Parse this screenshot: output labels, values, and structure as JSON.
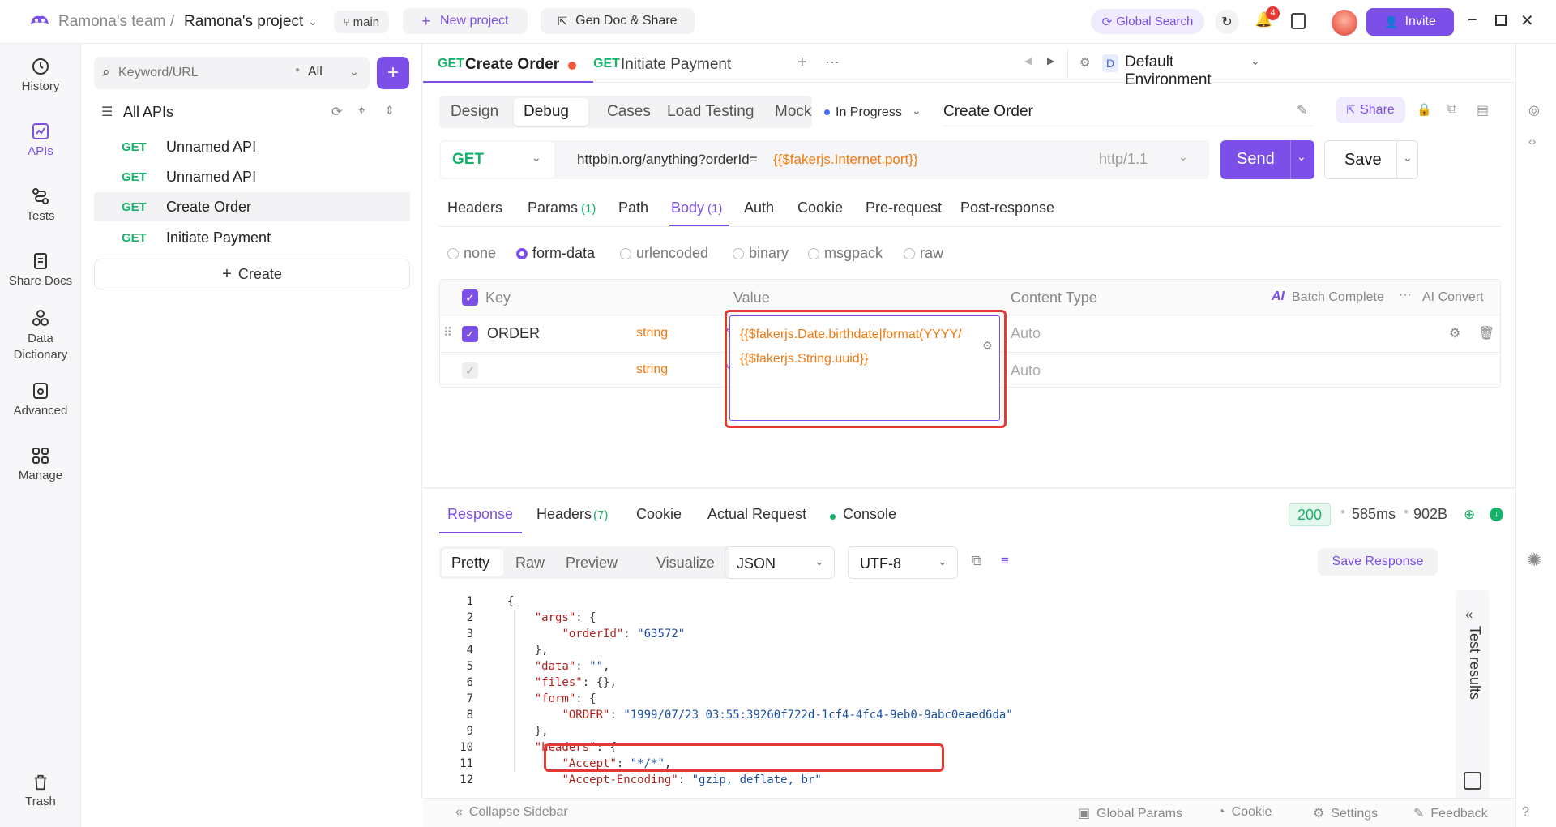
{
  "topbar": {
    "team": "Ramona's team",
    "separator": "/",
    "project": "Ramona's project",
    "branch": "main",
    "new_project": "New project",
    "gen_doc": "Gen Doc & Share",
    "global_search": "Global Search",
    "notif_count": "4",
    "invite": "Invite"
  },
  "nav": [
    {
      "label": "History",
      "icon": "history-icon"
    },
    {
      "label": "APIs",
      "icon": "apis-icon"
    },
    {
      "label": "Tests",
      "icon": "tests-icon"
    },
    {
      "label": "Share Docs",
      "icon": "share-docs-icon"
    },
    {
      "label": "Data\nDictionary",
      "icon": "data-dictionary-icon"
    },
    {
      "label": "Advanced",
      "icon": "advanced-icon"
    },
    {
      "label": "Manage",
      "icon": "manage-icon"
    },
    {
      "label": "Trash",
      "icon": "trash-icon"
    }
  ],
  "sidebar": {
    "search_placeholder": "Keyword/URL",
    "filter": "All",
    "tree_title": "All APIs",
    "apis": [
      {
        "method": "GET",
        "name": "Unnamed API"
      },
      {
        "method": "GET",
        "name": "Unnamed API"
      },
      {
        "method": "GET",
        "name": "Create Order"
      },
      {
        "method": "GET",
        "name": "Initiate Payment"
      }
    ],
    "create": "Create"
  },
  "tabs": [
    {
      "method": "GET",
      "name": "Create Order"
    },
    {
      "method": "GET",
      "name": "Initiate Payment"
    }
  ],
  "environment": {
    "badge": "D",
    "name": "Default Environment"
  },
  "modes": [
    "Design",
    "Debug",
    "Cases",
    "Load Testing",
    "Mock"
  ],
  "status": "In Progress",
  "api_name": "Create Order",
  "share": "Share",
  "request": {
    "method": "GET",
    "url": "httpbin.org/anything?orderId=",
    "url_var": "{{$fakerjs.Internet.port}}",
    "protocol": "http/1.1",
    "send": "Send",
    "save": "Save"
  },
  "req_tabs": [
    {
      "label": "Headers",
      "count": ""
    },
    {
      "label": "Params",
      "count": "(1)"
    },
    {
      "label": "Path",
      "count": ""
    },
    {
      "label": "Body",
      "count": "(1)"
    },
    {
      "label": "Auth",
      "count": ""
    },
    {
      "label": "Cookie",
      "count": ""
    },
    {
      "label": "Pre-request",
      "count": ""
    },
    {
      "label": "Post-response",
      "count": ""
    }
  ],
  "body_types": [
    "none",
    "form-data",
    "urlencoded",
    "binary",
    "msgpack",
    "raw"
  ],
  "table": {
    "col_key": "Key",
    "col_value": "Value",
    "col_content_type": "Content Type",
    "batch_complete": "Batch Complete",
    "ai_convert": "AI Convert",
    "ai_badge": "AI",
    "row1": {
      "key": "ORDER",
      "type": "string",
      "required": "*",
      "value_line1": "{{$fakerjs.Date.birthdate|format(YYYY/",
      "value_line2": "{{$fakerjs.String.uuid}}",
      "content_type": "Auto"
    },
    "row2": {
      "type": "string",
      "required": "*",
      "content_type": "Auto"
    }
  },
  "response": {
    "tabs": [
      {
        "label": "Response",
        "count": ""
      },
      {
        "label": "Headers",
        "count": "(7)"
      },
      {
        "label": "Cookie",
        "count": ""
      },
      {
        "label": "Actual Request",
        "count": ""
      },
      {
        "label": "Console",
        "count": ""
      }
    ],
    "status_code": "200",
    "time": "585ms",
    "size": "902B",
    "views": [
      "Pretty",
      "Raw",
      "Preview",
      "Visualize"
    ],
    "format": "JSON",
    "encoding": "UTF-8",
    "save_response": "Save Response",
    "test_results": "Test results"
  },
  "code_lines": [
    {
      "n": "1",
      "t": "{"
    },
    {
      "n": "2",
      "t": "    \"args\": {"
    },
    {
      "n": "3",
      "t": "        \"orderId\": \"63572\""
    },
    {
      "n": "4",
      "t": "    },"
    },
    {
      "n": "5",
      "t": "    \"data\": \"\","
    },
    {
      "n": "6",
      "t": "    \"files\": {},"
    },
    {
      "n": "7",
      "t": "    \"form\": {"
    },
    {
      "n": "8",
      "t": "        \"ORDER\": \"1999/07/23 03:55:39260f722d-1cf4-4fc4-9eb0-9abc0eaed6da\""
    },
    {
      "n": "9",
      "t": "    },"
    },
    {
      "n": "10",
      "t": "    \"headers\": {"
    },
    {
      "n": "11",
      "t": "        \"Accept\": \"*/*\","
    },
    {
      "n": "12",
      "t": "        \"Accept-Encoding\": \"gzip, deflate, br\""
    }
  ],
  "footer": {
    "collapse": "Collapse Sidebar",
    "global_params": "Global Params",
    "cookie": "Cookie",
    "settings": "Settings",
    "feedback": "Feedback"
  },
  "colors": {
    "accent": "#7b4fe8",
    "get": "#17b26a",
    "var": "#f07a10",
    "highlight": "#e53935"
  }
}
